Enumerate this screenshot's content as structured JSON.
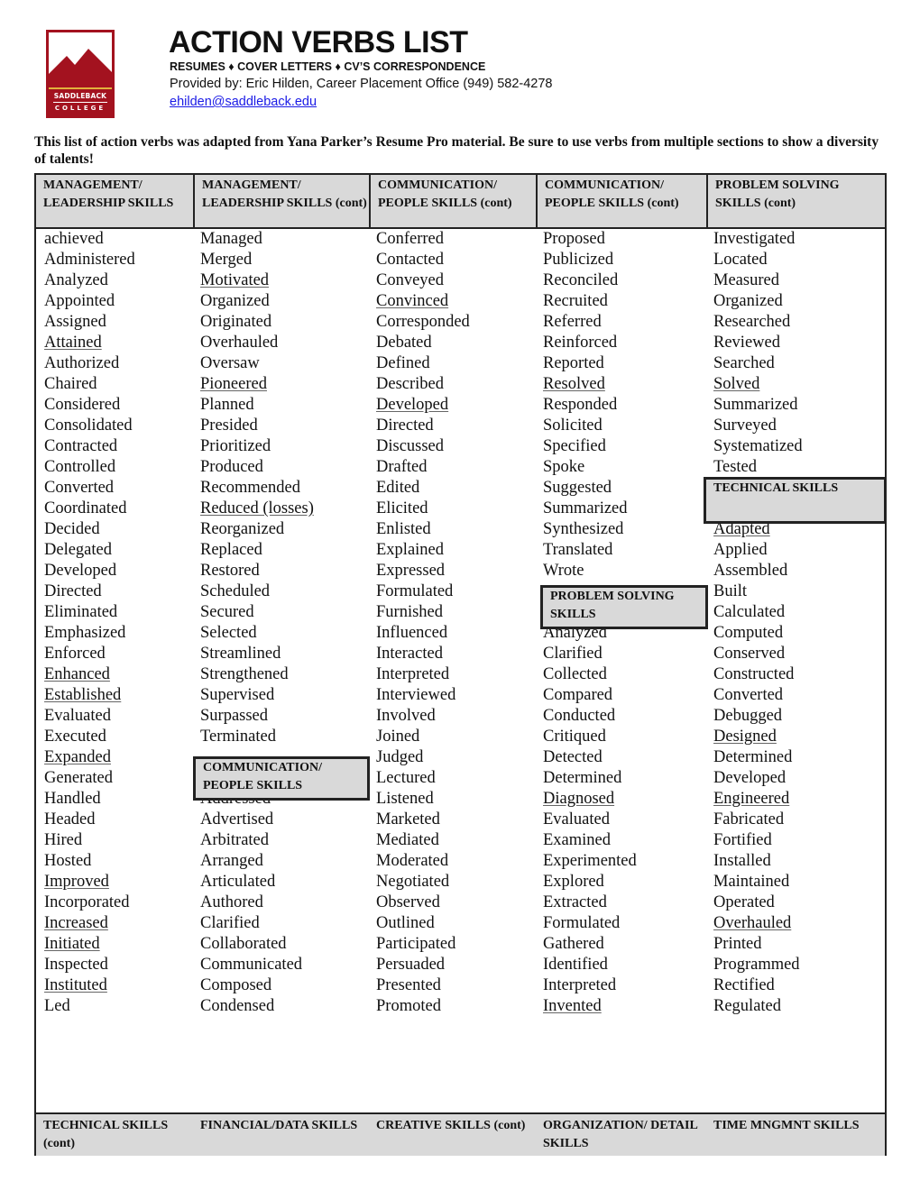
{
  "logo": {
    "line1": "SADDLEBACK",
    "line2": "COLLEGE",
    "colors": {
      "maroon": "#a3121f",
      "gold": "#e2b13c"
    }
  },
  "header": {
    "title": "ACTION VERBS LIST",
    "subtitle": "RESUMES ♦ COVER LETTERS ♦ CV’S  CORRESPONDENCE",
    "provided_by": "Provided by: Eric Hilden, Career Placement Office (949) 582-4278",
    "email": "ehilden@saddleback.edu"
  },
  "intro": "This list of action verbs was adapted from Yana Parker’s Resume Pro material.  Be sure to use verbs from multiple sections to show a diversity of talents!",
  "table": {
    "top_headers": [
      "MANAGEMENT/ LEADERSHIP SKILLS",
      "MANAGEMENT/ LEADERSHIP SKILLS (cont)",
      "COMMUNICATION/ PEOPLE SKILLS (cont)",
      "COMMUNICATION/ PEOPLE SKILLS (cont)",
      "PROBLEM SOLVING SKILLS (cont)"
    ],
    "bottom_headers": [
      "TECHNICAL SKILLS (cont)",
      "FINANCIAL/DATA SKILLS",
      "CREATIVE SKILLS (cont)",
      "ORGANIZATION/ DETAIL SKILLS",
      "TIME MNGMNT SKILLS"
    ],
    "inline_headers": {
      "communication_people": "COMMUNICATION/ PEOPLE SKILLS",
      "problem_solving": "PROBLEM SOLVING SKILLS",
      "technical": "TECHNICAL SKILLS"
    },
    "columns": [
      {
        "words": [
          {
            "t": "achieved"
          },
          {
            "t": "Administered"
          },
          {
            "t": "Analyzed"
          },
          {
            "t": "Appointed"
          },
          {
            "t": "Assigned"
          },
          {
            "t": "Attained",
            "u": true
          },
          {
            "t": "Authorized"
          },
          {
            "t": "Chaired"
          },
          {
            "t": "Considered"
          },
          {
            "t": "Consolidated"
          },
          {
            "t": "Contracted"
          },
          {
            "t": "Controlled"
          },
          {
            "t": "Converted"
          },
          {
            "t": "Coordinated"
          },
          {
            "t": "Decided"
          },
          {
            "t": "Delegated"
          },
          {
            "t": "Developed"
          },
          {
            "t": "Directed"
          },
          {
            "t": "Eliminated"
          },
          {
            "t": "Emphasized"
          },
          {
            "t": "Enforced"
          },
          {
            "t": "Enhanced",
            "u": true
          },
          {
            "t": "Established",
            "u": true
          },
          {
            "t": "Evaluated"
          },
          {
            "t": "Executed"
          },
          {
            "t": "Expanded",
            "u": true
          },
          {
            "t": "Generated"
          },
          {
            "t": "Handled"
          },
          {
            "t": "Headed"
          },
          {
            "t": "Hired"
          },
          {
            "t": "Hosted"
          },
          {
            "t": "Improved",
            "u": true
          },
          {
            "t": "Incorporated"
          },
          {
            "t": "Increased",
            "u": true
          },
          {
            "t": "Initiated",
            "u": true
          },
          {
            "t": "Inspected"
          },
          {
            "t": "Instituted",
            "u": true
          },
          {
            "t": "Led"
          }
        ]
      },
      {
        "words_before": [
          {
            "t": "Managed"
          },
          {
            "t": "Merged"
          },
          {
            "t": "Motivated",
            "u": true
          },
          {
            "t": "Organized"
          },
          {
            "t": "Originated"
          },
          {
            "t": "Overhauled"
          },
          {
            "t": "Oversaw"
          },
          {
            "t": "Pioneered",
            "u": true
          },
          {
            "t": "Planned"
          },
          {
            "t": "Presided"
          },
          {
            "t": "Prioritized"
          },
          {
            "t": "Produced"
          },
          {
            "t": "Recommended"
          },
          {
            "t": "Reduced (losses)",
            "u": true
          },
          {
            "t": "Reorganized"
          },
          {
            "t": "Replaced"
          },
          {
            "t": "Restored"
          },
          {
            "t": "Scheduled"
          },
          {
            "t": "Secured"
          },
          {
            "t": "Selected"
          },
          {
            "t": "Streamlined"
          },
          {
            "t": "Strengthened"
          },
          {
            "t": "Supervised"
          },
          {
            "t": "Surpassed"
          },
          {
            "t": "Terminated"
          }
        ],
        "words_after": [
          {
            "t": "Addressed"
          },
          {
            "t": "Advertised"
          },
          {
            "t": "Arbitrated"
          },
          {
            "t": "Arranged"
          },
          {
            "t": "Articulated"
          },
          {
            "t": "Authored"
          },
          {
            "t": "Clarified"
          },
          {
            "t": "Collaborated"
          },
          {
            "t": "Communicated"
          },
          {
            "t": "Composed"
          },
          {
            "t": "Condensed"
          }
        ]
      },
      {
        "words": [
          {
            "t": "Conferred"
          },
          {
            "t": "Contacted"
          },
          {
            "t": "Conveyed"
          },
          {
            "t": "Convinced",
            "u": true
          },
          {
            "t": "Corresponded"
          },
          {
            "t": "Debated"
          },
          {
            "t": "Defined"
          },
          {
            "t": "Described"
          },
          {
            "t": "Developed",
            "u": true
          },
          {
            "t": "Directed"
          },
          {
            "t": "Discussed"
          },
          {
            "t": "Drafted"
          },
          {
            "t": "Edited"
          },
          {
            "t": "Elicited"
          },
          {
            "t": "Enlisted"
          },
          {
            "t": "Explained"
          },
          {
            "t": "Expressed"
          },
          {
            "t": "Formulated"
          },
          {
            "t": "Furnished"
          },
          {
            "t": "Influenced"
          },
          {
            "t": "Interacted"
          },
          {
            "t": "Interpreted"
          },
          {
            "t": "Interviewed"
          },
          {
            "t": "Involved"
          },
          {
            "t": "Joined"
          },
          {
            "t": "Judged"
          },
          {
            "t": "Lectured"
          },
          {
            "t": "Listened"
          },
          {
            "t": "Marketed"
          },
          {
            "t": "Mediated"
          },
          {
            "t": "Moderated"
          },
          {
            "t": "Negotiated"
          },
          {
            "t": "Observed"
          },
          {
            "t": "Outlined"
          },
          {
            "t": "Participated"
          },
          {
            "t": "Persuaded"
          },
          {
            "t": "Presented"
          },
          {
            "t": "Promoted"
          }
        ]
      },
      {
        "words_before": [
          {
            "t": "Proposed"
          },
          {
            "t": "Publicized"
          },
          {
            "t": "Reconciled"
          },
          {
            "t": "Recruited"
          },
          {
            "t": "Referred"
          },
          {
            "t": "Reinforced"
          },
          {
            "t": "Reported"
          },
          {
            "t": "Resolved",
            "u": true
          },
          {
            "t": "Responded"
          },
          {
            "t": "Solicited"
          },
          {
            "t": "Specified"
          },
          {
            "t": "Spoke"
          },
          {
            "t": "Suggested"
          },
          {
            "t": "Summarized"
          },
          {
            "t": "Synthesized"
          },
          {
            "t": "Translated"
          },
          {
            "t": "Wrote"
          }
        ],
        "words_after": [
          {
            "t": "Analyzed"
          },
          {
            "t": "Clarified"
          },
          {
            "t": "Collected"
          },
          {
            "t": "Compared"
          },
          {
            "t": "Conducted"
          },
          {
            "t": "Critiqued"
          },
          {
            "t": "Detected"
          },
          {
            "t": "Determined"
          },
          {
            "t": "Diagnosed",
            "u": true
          },
          {
            "t": "Evaluated"
          },
          {
            "t": "Examined"
          },
          {
            "t": "Experimented"
          },
          {
            "t": "Explored"
          },
          {
            "t": "Extracted"
          },
          {
            "t": "Formulated"
          },
          {
            "t": "Gathered"
          },
          {
            "t": "Identified"
          },
          {
            "t": "Interpreted"
          },
          {
            "t": "Invented",
            "u": true
          }
        ]
      },
      {
        "words_before": [
          {
            "t": "Investigated"
          },
          {
            "t": "Located"
          },
          {
            "t": "Measured"
          },
          {
            "t": "Organized"
          },
          {
            "t": "Researched"
          },
          {
            "t": "Reviewed"
          },
          {
            "t": "Searched"
          },
          {
            "t": "Solved",
            "u": true
          },
          {
            "t": "Summarized"
          },
          {
            "t": "Surveyed"
          },
          {
            "t": "Systematized"
          },
          {
            "t": "Tested"
          }
        ],
        "words_after": [
          {
            "t": "Adapted",
            "u": true
          },
          {
            "t": "Applied"
          },
          {
            "t": "Assembled"
          },
          {
            "t": "Built"
          },
          {
            "t": "Calculated"
          },
          {
            "t": "Computed"
          },
          {
            "t": "Conserved"
          },
          {
            "t": "Constructed"
          },
          {
            "t": "Converted"
          },
          {
            "t": "Debugged"
          },
          {
            "t": "Designed",
            "u": true
          },
          {
            "t": "Determined"
          },
          {
            "t": "Developed"
          },
          {
            "t": "Engineered",
            "u": true
          },
          {
            "t": "Fabricated"
          },
          {
            "t": "Fortified"
          },
          {
            "t": "Installed"
          },
          {
            "t": "Maintained"
          },
          {
            "t": "Operated"
          },
          {
            "t": "Overhauled",
            "u": true
          },
          {
            "t": "Printed"
          },
          {
            "t": "Programmed"
          },
          {
            "t": "Rectified"
          },
          {
            "t": "Regulated"
          }
        ]
      }
    ]
  }
}
